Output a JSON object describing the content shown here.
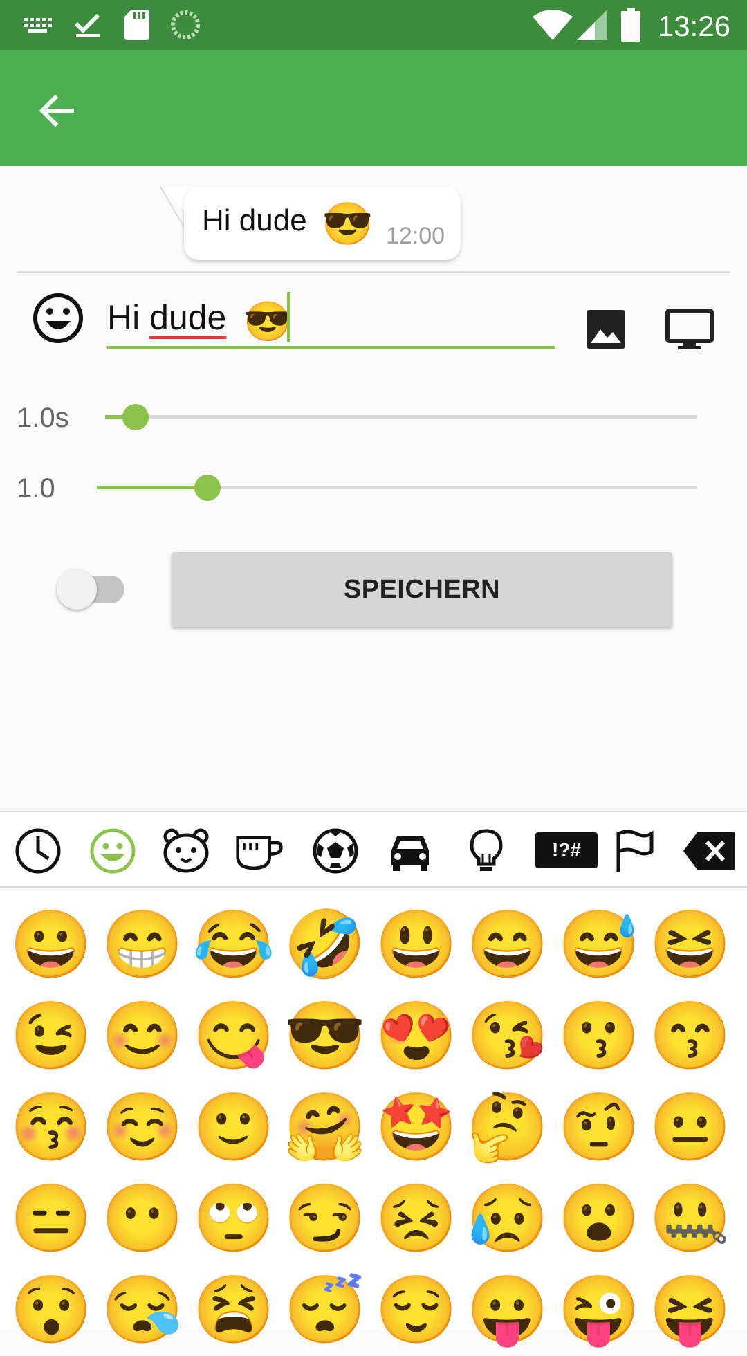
{
  "status_bar": {
    "time": "13:26",
    "left_icons": [
      "keyboard-icon",
      "download-done-icon",
      "sd-card-icon",
      "sync-spinner-icon"
    ],
    "right_icons": [
      "wifi-icon",
      "signal-icon",
      "battery-icon"
    ]
  },
  "app_bar": {
    "back_icon": "arrow-back-icon",
    "color": "#4caf50"
  },
  "message": {
    "text": "Hi dude",
    "emoji": "😎",
    "time": "12:00"
  },
  "composer": {
    "text_word1": "Hi",
    "text_word2": "dude",
    "emoji": "😎",
    "accent": "#8bc34a"
  },
  "sliders": [
    {
      "label": "1.0s",
      "level": 0.05
    },
    {
      "label": "1.0",
      "level": 0.18
    }
  ],
  "toggle": {
    "on": false
  },
  "save_button": {
    "label": "SPEICHERN"
  },
  "emoji_categories": [
    "recent-icon",
    "smileys-icon",
    "animals-icon",
    "food-icon",
    "activity-icon",
    "travel-icon",
    "objects-icon",
    "symbols-icon",
    "flags-icon",
    "backspace-icon"
  ],
  "symbols_label": "!?#",
  "emoji_grid": [
    [
      "😀",
      "😁",
      "😂",
      "🤣",
      "😃",
      "😄",
      "😅",
      "😆"
    ],
    [
      "😉",
      "😊",
      "😋",
      "😎",
      "😍",
      "😘",
      "😗",
      "😙"
    ],
    [
      "😚",
      "☺️",
      "🙂",
      "🤗",
      "🤩",
      "🤔",
      "🤨",
      "😐"
    ],
    [
      "😑",
      "😶",
      "🙄",
      "😏",
      "😣",
      "😥",
      "😮",
      "🤐"
    ],
    [
      "😯",
      "😪",
      "😫",
      "😴",
      "😌",
      "😛",
      "😜",
      "😝"
    ]
  ]
}
